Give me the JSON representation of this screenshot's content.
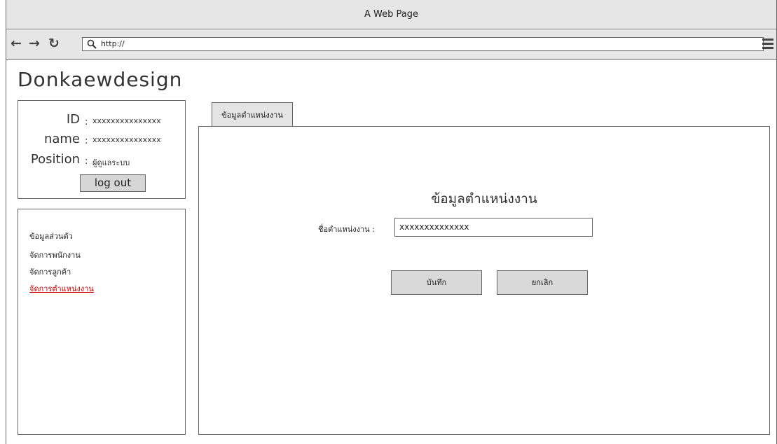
{
  "window": {
    "title": "A Web Page"
  },
  "browser": {
    "url": "http://"
  },
  "logo": "Donkaewdesign",
  "user": {
    "id_label": "ID",
    "id_value": "xxxxxxxxxxxxxxx",
    "name_label": "name",
    "name_value": "xxxxxxxxxxxxxxx",
    "position_label": "Position",
    "position_value": "ผู้ดูแลระบบ",
    "separator": ":",
    "logout_label": "log out"
  },
  "menu": {
    "items": [
      {
        "label": "ข้อมูลส่วนตัว",
        "active": false
      },
      {
        "label": "จัดการพนักงาน",
        "active": false
      },
      {
        "label": "จัดการลูกค้า",
        "active": false
      },
      {
        "label": "จัดการตำแหน่งงาน",
        "active": true
      }
    ]
  },
  "tab": {
    "label": "ข้อมูลตำแหน่งงาน"
  },
  "form": {
    "heading": "ข้อมูลตำแหน่งงาน",
    "field_label": "ชื่อตำแหน่งงาน :",
    "field_value": "xxxxxxxxxxxxxx",
    "save_label": "บันทึก",
    "cancel_label": "ยกเลิก"
  },
  "colors": {
    "active_link": "#cc0000",
    "chrome": "#e6e6e6",
    "button": "#d9d9d9"
  }
}
